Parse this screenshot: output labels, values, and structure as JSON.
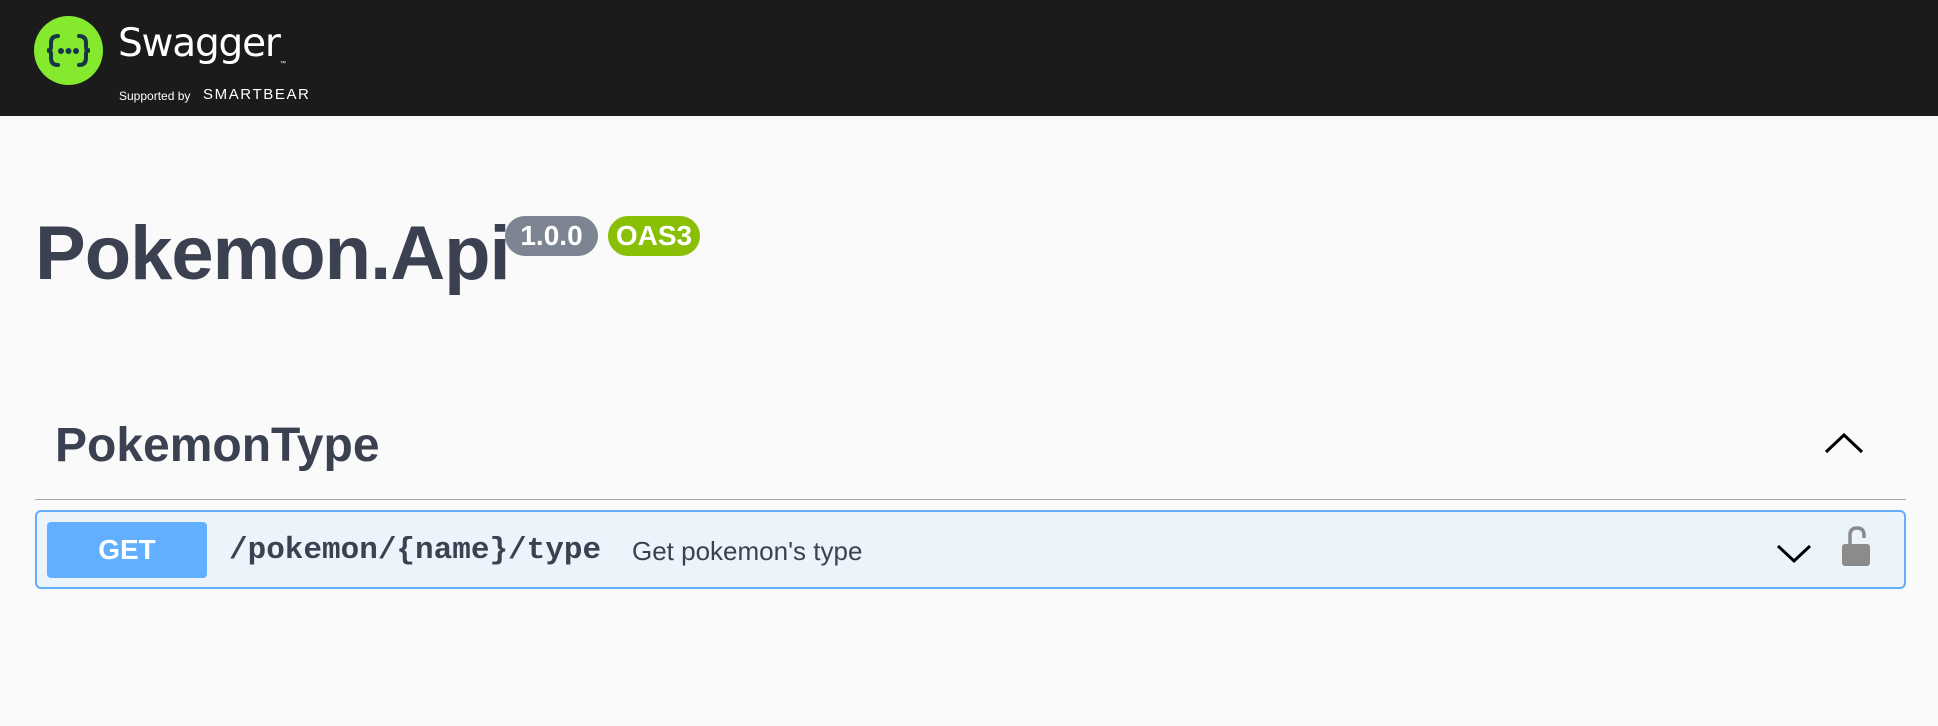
{
  "topbar": {
    "logo_word": "Swagger",
    "logo_tm": "™",
    "supported_by": "Supported by",
    "brand": "SMARTBEAR",
    "logo_color": "#85ea2d",
    "logo_icon": "curly-braces-dots-icon"
  },
  "info": {
    "title": "Pokemon.Api",
    "version": "1.0.0",
    "oas_badge": "OAS3"
  },
  "tags": [
    {
      "name": "PokemonType",
      "expanded": true,
      "operations": [
        {
          "method": "GET",
          "path": "/pokemon/{name}/type",
          "summary": "Get pokemon's type",
          "locked": false,
          "expanded": false
        }
      ]
    }
  ],
  "colors": {
    "topbar_bg": "#1b1b1b",
    "text": "#3b4151",
    "get_method": "#61affe",
    "get_bg": "#ebf3fb",
    "version_badge": "#7d8492",
    "oas_badge": "#89bf04"
  },
  "icons": {
    "tag_toggle": "chevron-up-icon",
    "op_toggle": "chevron-down-icon",
    "lock": "unlocked-padlock-icon"
  }
}
